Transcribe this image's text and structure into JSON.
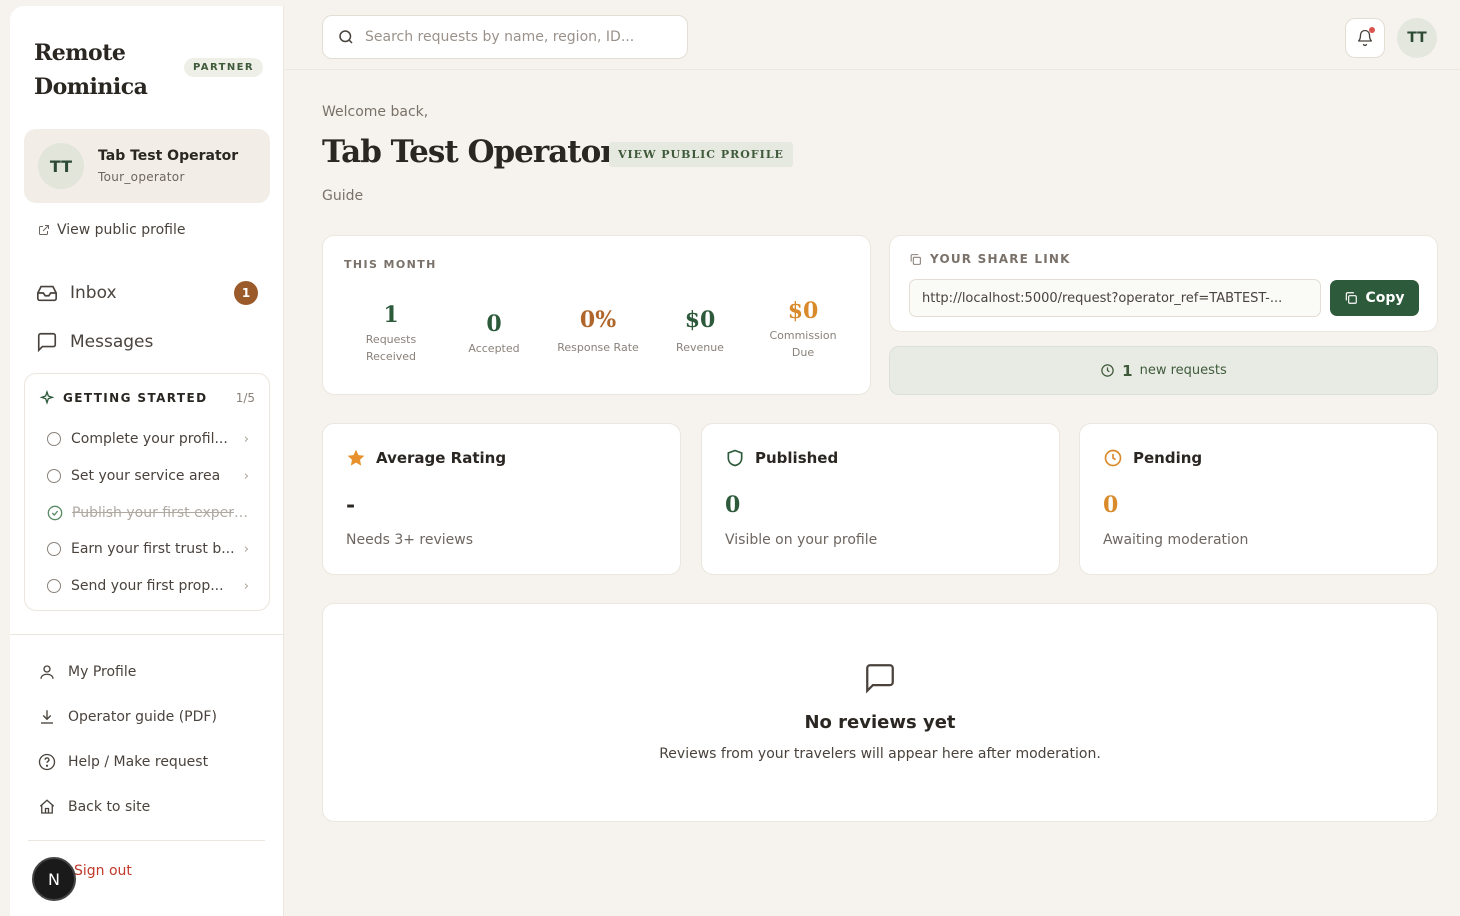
{
  "brand": {
    "name_line1": "Remote",
    "name_line2": "Dominica",
    "badge": "PARTNER"
  },
  "user": {
    "initials": "TT",
    "name": "Tab Test Operator",
    "role": "Tour_operator"
  },
  "sidebar": {
    "view_profile": "View public profile",
    "nav": [
      {
        "label": "Inbox",
        "badge": "1",
        "icon": "inbox-icon"
      },
      {
        "label": "Messages",
        "icon": "message-icon"
      }
    ],
    "getting_started": {
      "title": "GETTING STARTED",
      "count": "1/5",
      "items": [
        {
          "label": "Complete your profil...",
          "done": false
        },
        {
          "label": "Set your service area",
          "done": false
        },
        {
          "label": "Publish your first experi...",
          "done": true
        },
        {
          "label": "Earn your first trust b...",
          "done": false
        },
        {
          "label": "Send your first prop...",
          "done": false
        }
      ]
    },
    "bottom_links": [
      {
        "label": "My Profile",
        "icon": "user-icon"
      },
      {
        "label": "Operator guide (PDF)",
        "icon": "download-icon"
      },
      {
        "label": "Help / Make request",
        "icon": "help-icon"
      },
      {
        "label": "Back to site",
        "icon": "home-icon"
      }
    ],
    "sign_out": "Sign out",
    "fab": "N"
  },
  "topbar": {
    "search_placeholder": "Search requests by name, region, ID...",
    "avatar": "TT"
  },
  "main": {
    "welcome": "Welcome back,",
    "title": "Tab Test Operator",
    "public_button": "VIEW PUBLIC PROFILE",
    "subtitle": "Guide",
    "this_month": {
      "label": "THIS MONTH",
      "stats": [
        {
          "value": "1",
          "label1": "Requests",
          "label2": "Received",
          "color": "#2d5a3a"
        },
        {
          "value": "0",
          "label1": "Accepted",
          "label2": "",
          "color": "#2d5a3a"
        },
        {
          "value": "0%",
          "label1": "Response Rate",
          "label2": "",
          "color": "#b0662a"
        },
        {
          "value": "$0",
          "label1": "Revenue",
          "label2": "",
          "color": "#2d5a3a"
        },
        {
          "value": "$0",
          "label1": "Commission",
          "label2": "Due",
          "color": "#d98a2b"
        }
      ]
    },
    "share": {
      "label": "YOUR SHARE LINK",
      "url": "http://localhost:5000/request?operator_ref=TABTEST-...",
      "copy": "Copy"
    },
    "new_requests": {
      "count": "1",
      "text": "new requests"
    },
    "cards": [
      {
        "title": "Average Rating",
        "value": "-",
        "sub": "Needs 3+ reviews",
        "icon": "star-icon",
        "color": "#2a2622",
        "accent": "#e8912c"
      },
      {
        "title": "Published",
        "value": "0",
        "sub": "Visible on your profile",
        "icon": "shield-icon",
        "color": "#2d5a3a",
        "accent": "#2d5a3a"
      },
      {
        "title": "Pending",
        "value": "0",
        "sub": "Awaiting moderation",
        "icon": "clock-icon",
        "color": "#d98a2b",
        "accent": "#d98a2b"
      }
    ],
    "reviews": {
      "title": "No reviews yet",
      "sub": "Reviews from your travelers will appear here after moderation."
    }
  }
}
